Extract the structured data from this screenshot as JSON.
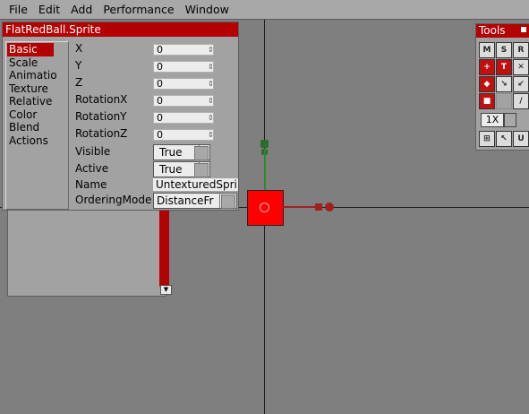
{
  "menu": [
    "File",
    "Edit",
    "Add",
    "Performance",
    "Window"
  ],
  "prop_window": {
    "title": "FlatRedBall.Sprite",
    "categories": [
      "Basic",
      "Scale",
      "Animatio",
      "Texture",
      "Relative",
      "Color",
      "Blend",
      "Actions"
    ],
    "selected_category": "Basic",
    "rows": [
      {
        "label": "X",
        "value": "0"
      },
      {
        "label": "Y",
        "value": "0"
      },
      {
        "label": "Z",
        "value": "0"
      },
      {
        "label": "RotationX",
        "value": "0"
      },
      {
        "label": "RotationY",
        "value": "0"
      },
      {
        "label": "RotationZ",
        "value": "0"
      },
      {
        "label": "Visible",
        "value": "True"
      },
      {
        "label": "Active",
        "value": "True"
      },
      {
        "label": "Name",
        "value": "UntexturedSpri"
      },
      {
        "label": "OrderingMode",
        "value": "DistanceFr"
      }
    ]
  },
  "tools_window": {
    "title": "Tools",
    "buttons_row1": [
      "M",
      "S",
      "R"
    ],
    "zoom": "1X"
  },
  "colors": {
    "accent": "#b40000",
    "canvas": "#7f7f7f",
    "sprite": "#ff0000",
    "gizmo_y": "#2f8a2f",
    "gizmo_x": "#a02020"
  }
}
